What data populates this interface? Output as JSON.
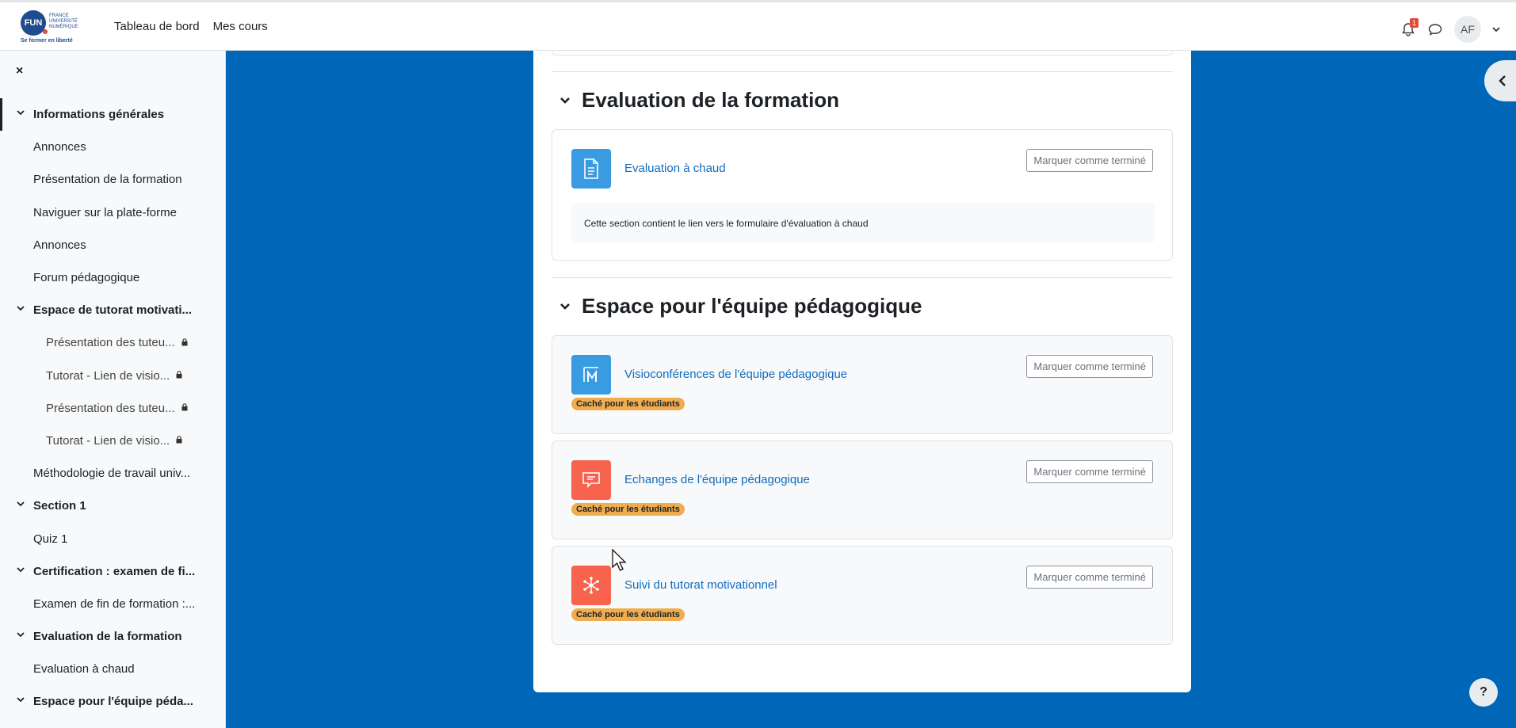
{
  "logo": {
    "mark": "FUN",
    "lines": [
      "FRANCE",
      "UNIVERSITÉ",
      "NUMÉRIQUE"
    ],
    "tagline": "Se former en liberté"
  },
  "topnav": {
    "dashboard": "Tableau de bord",
    "my_courses": "Mes cours"
  },
  "notifications": {
    "count": "1",
    "icon": "bell-icon"
  },
  "messages": {
    "icon": "chat-icon"
  },
  "user": {
    "initials": "AF"
  },
  "drawer": {
    "close_icon": "×",
    "items": [
      {
        "label": "Informations générales",
        "type": "section"
      },
      {
        "label": "Annonces",
        "type": "item"
      },
      {
        "label": "Présentation de la formation",
        "type": "item"
      },
      {
        "label": "Naviguer sur la plate-forme",
        "type": "item"
      },
      {
        "label": "Annonces",
        "type": "item"
      },
      {
        "label": "Forum pédagogique",
        "type": "item"
      },
      {
        "label": "Espace de tutorat motivati...",
        "type": "section"
      },
      {
        "label": "Présentation des tuteu...",
        "type": "sub",
        "locked": true
      },
      {
        "label": "Tutorat - Lien de visio...",
        "type": "sub",
        "locked": true
      },
      {
        "label": "Présentation des tuteu...",
        "type": "sub",
        "locked": true
      },
      {
        "label": "Tutorat - Lien de visio...",
        "type": "sub",
        "locked": true
      },
      {
        "label": "Méthodologie de travail univ...",
        "type": "item"
      },
      {
        "label": "Section 1",
        "type": "section"
      },
      {
        "label": "Quiz 1",
        "type": "item"
      },
      {
        "label": "Certification : examen de fi...",
        "type": "section"
      },
      {
        "label": "Examen de fin de formation :...",
        "type": "item"
      },
      {
        "label": "Evaluation de la formation",
        "type": "section"
      },
      {
        "label": "Evaluation à chaud",
        "type": "item"
      },
      {
        "label": "Espace pour l'équipe péda...",
        "type": "section"
      }
    ]
  },
  "sections": [
    {
      "title": "Evaluation de la formation",
      "activities": [
        {
          "name": "Evaluation à chaud",
          "button": "Marquer comme terminé",
          "icon": "page-icon",
          "color": "#399be2",
          "description": "Cette section contient le lien vers le formulaire d'évaluation à chaud"
        }
      ]
    },
    {
      "title": "Espace pour l'équipe pédagogique",
      "activities": [
        {
          "name": "Visioconférences de l'équipe pédagogique",
          "button": "Marquer comme terminé",
          "icon": "bigbluebutton-icon",
          "color": "#399be2",
          "badge": "Caché pour les étudiants"
        },
        {
          "name": "Echanges de l'équipe pédagogique",
          "button": "Marquer comme terminé",
          "icon": "forum-icon",
          "color": "#f7634d",
          "badge": "Caché pour les étudiants"
        },
        {
          "name": "Suivi du tutorat motivationnel",
          "button": "Marquer comme terminé",
          "icon": "hub-icon",
          "color": "#f7634d",
          "badge": "Caché pour les étudiants"
        }
      ]
    }
  ],
  "help": {
    "label": "?"
  },
  "colors": {
    "background": "#0067b8",
    "link": "#0f6cbf",
    "badge": "#f0ad4e"
  }
}
